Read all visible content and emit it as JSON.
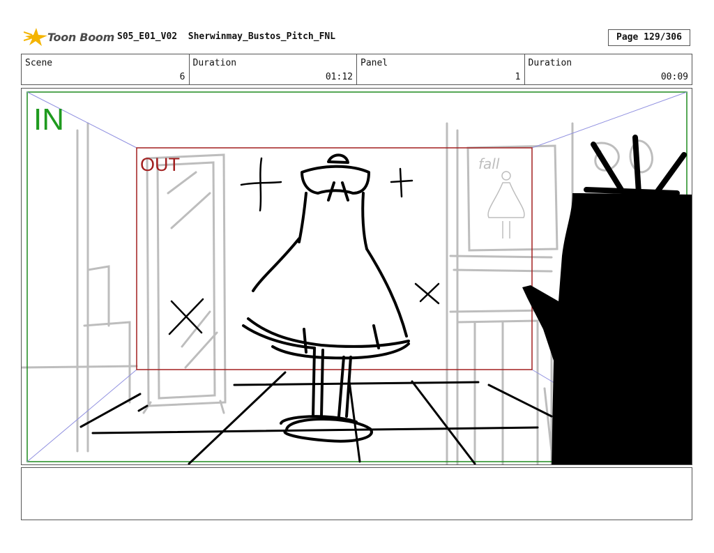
{
  "header": {
    "logo_text": "Toon Boom",
    "project_title": "S05_E01_V02  Sherwinmay_Bustos_Pitch_FNL",
    "page_label": "Page 129/306"
  },
  "info": [
    {
      "label": "Scene",
      "value": "6"
    },
    {
      "label": "Duration",
      "value": "01:12"
    },
    {
      "label": "Panel",
      "value": "1"
    },
    {
      "label": "Duration",
      "value": "00:09"
    }
  ],
  "panel": {
    "in_label": "IN",
    "out_label": "OUT",
    "poster_text": "fall",
    "colors": {
      "in_frame": "#1f8a1f",
      "out_frame": "#a21f1f",
      "guides": "#9090e0",
      "sketch": "#bdbdbd",
      "ink": "#000000"
    }
  },
  "notes": {
    "text": ""
  }
}
